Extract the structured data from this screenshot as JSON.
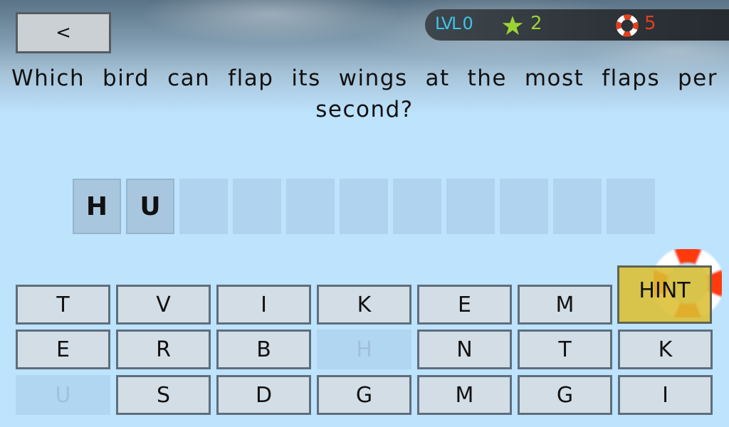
{
  "header": {
    "back_label": "<",
    "level_label": "LVL",
    "level_value": "0",
    "stars": "2",
    "hints_remaining": "5",
    "colors": {
      "level": "#3fc3e6",
      "stars": "#9cd334",
      "hints": "#e2401c"
    }
  },
  "question": {
    "line1": "Which bird can flap its wings at the most flaps per",
    "line2": "second?"
  },
  "answer_slots": [
    "H",
    "U",
    "",
    "",
    "",
    "",
    "",
    "",
    "",
    "",
    ""
  ],
  "keyboard": {
    "rows": [
      [
        {
          "letter": "T",
          "used": false
        },
        {
          "letter": "V",
          "used": false
        },
        {
          "letter": "I",
          "used": false
        },
        {
          "letter": "K",
          "used": false
        },
        {
          "letter": "E",
          "used": false
        },
        {
          "letter": "M",
          "used": false
        }
      ],
      [
        {
          "letter": "E",
          "used": false
        },
        {
          "letter": "R",
          "used": false
        },
        {
          "letter": "B",
          "used": false
        },
        {
          "letter": "H",
          "used": true
        },
        {
          "letter": "N",
          "used": false
        },
        {
          "letter": "T",
          "used": false
        },
        {
          "letter": "K",
          "used": false
        }
      ],
      [
        {
          "letter": "U",
          "used": true
        },
        {
          "letter": "S",
          "used": false
        },
        {
          "letter": "D",
          "used": false
        },
        {
          "letter": "G",
          "used": false
        },
        {
          "letter": "M",
          "used": false
        },
        {
          "letter": "G",
          "used": false
        },
        {
          "letter": "I",
          "used": false
        }
      ]
    ],
    "hint_label": "HINT"
  },
  "icons": {
    "back": "chevron-left-icon",
    "star": "star-icon",
    "hint": "lifebuoy-icon"
  }
}
